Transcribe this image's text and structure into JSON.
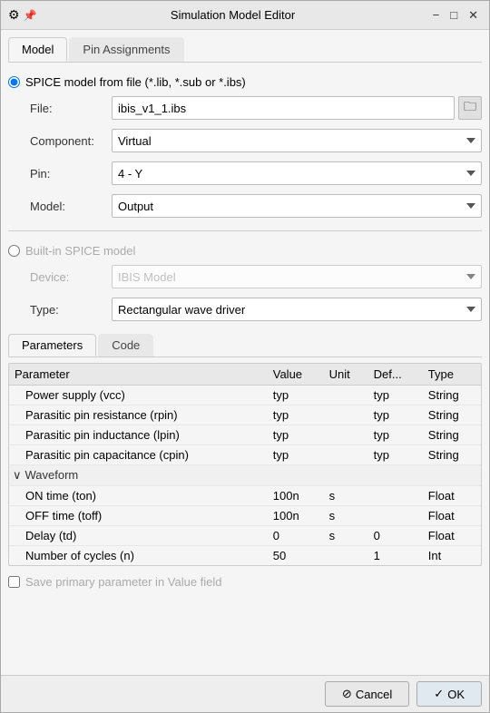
{
  "window": {
    "title": "Simulation Model Editor",
    "icon": "⚙",
    "close_label": "✕",
    "minimize_label": "−",
    "maximize_label": "□"
  },
  "tabs": [
    {
      "id": "model",
      "label": "Model",
      "active": true
    },
    {
      "id": "pin-assignments",
      "label": "Pin Assignments",
      "active": false
    }
  ],
  "spice_from_file": {
    "radio_label": "SPICE model from file (*.lib, *.sub or *.ibs)",
    "file_label": "File:",
    "file_value": "ibis_v1_1.ibs",
    "file_btn_label": "📁",
    "component_label": "Component:",
    "component_value": "Virtual",
    "pin_label": "Pin:",
    "pin_value": "4 - Y",
    "model_label": "Model:",
    "model_value": "Output"
  },
  "builtin_spice": {
    "radio_label": "Built-in SPICE model",
    "device_label": "Device:",
    "device_placeholder": "IBIS Model",
    "device_disabled": true,
    "type_label": "Type:",
    "type_value": "Rectangular wave driver"
  },
  "inner_tabs": [
    {
      "id": "parameters",
      "label": "Parameters",
      "active": true
    },
    {
      "id": "code",
      "label": "Code",
      "active": false
    }
  ],
  "table": {
    "headers": [
      "Parameter",
      "Value",
      "Unit",
      "Def...",
      "Type"
    ],
    "rows": [
      {
        "type": "data",
        "cells": [
          "Power supply (vcc)",
          "typ",
          "",
          "typ",
          "String"
        ]
      },
      {
        "type": "data",
        "cells": [
          "Parasitic pin resistance (rpin)",
          "typ",
          "",
          "typ",
          "String"
        ]
      },
      {
        "type": "data",
        "cells": [
          "Parasitic pin inductance (lpin)",
          "typ",
          "",
          "typ",
          "String"
        ]
      },
      {
        "type": "data",
        "cells": [
          "Parasitic pin capacitance (cpin)",
          "typ",
          "",
          "typ",
          "String"
        ]
      },
      {
        "type": "group",
        "label": "Waveform"
      },
      {
        "type": "data",
        "cells": [
          "ON time (ton)",
          "100n",
          "s",
          "",
          "Float"
        ]
      },
      {
        "type": "data",
        "cells": [
          "OFF time (toff)",
          "100n",
          "s",
          "",
          "Float"
        ]
      },
      {
        "type": "data",
        "cells": [
          "Delay (td)",
          "0",
          "s",
          "0",
          "Float"
        ]
      },
      {
        "type": "data",
        "cells": [
          "Number of cycles (n)",
          "50",
          "",
          "1",
          "Int"
        ]
      }
    ]
  },
  "save_checkbox": {
    "label": "Save primary parameter in Value field",
    "checked": false
  },
  "buttons": {
    "cancel_label": "Cancel",
    "ok_label": "OK",
    "cancel_icon": "⊘",
    "ok_icon": "✓"
  }
}
